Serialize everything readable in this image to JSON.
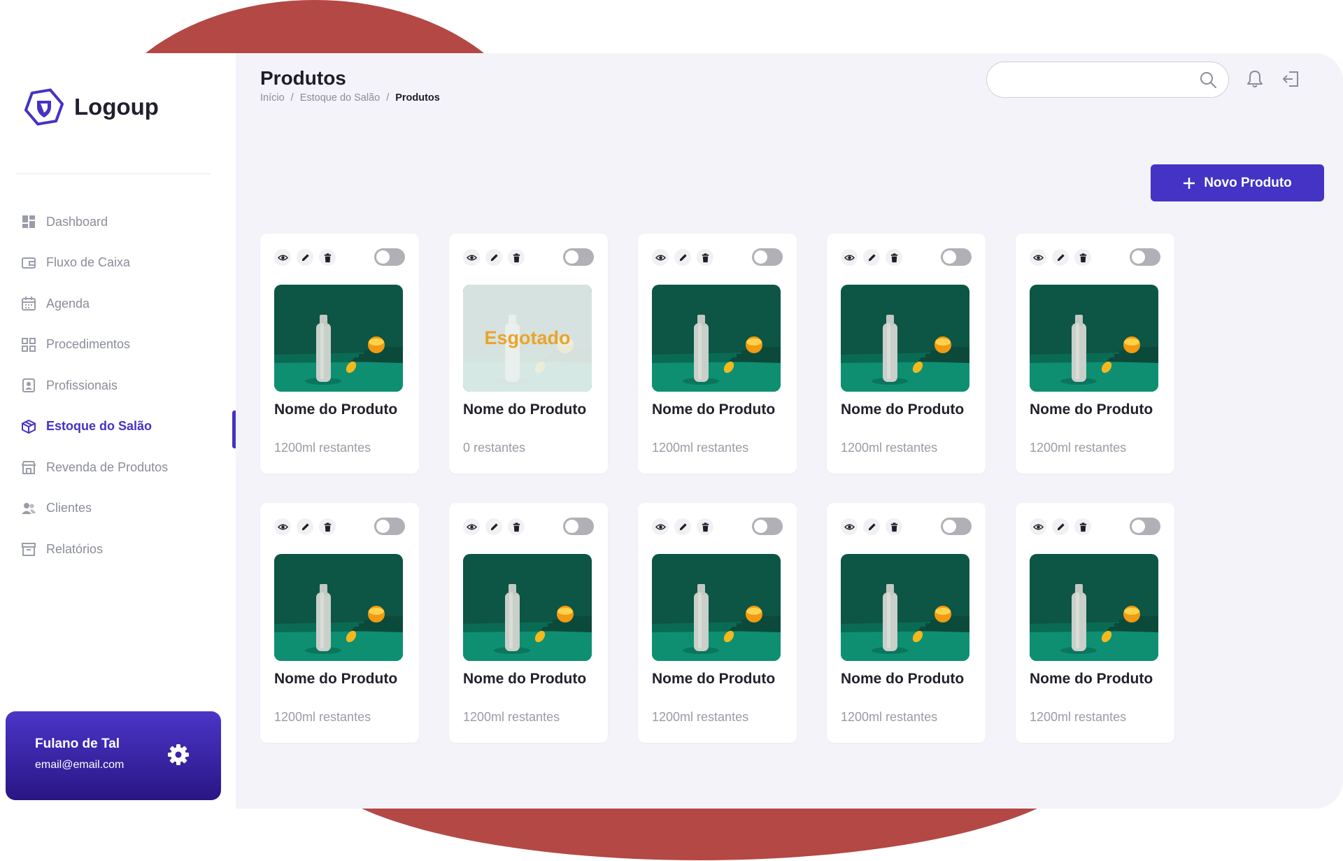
{
  "brand": {
    "name": "Logoup"
  },
  "nav": {
    "items": [
      {
        "label": "Dashboard",
        "icon": "dashboard-icon",
        "active": false
      },
      {
        "label": "Fluxo de Caixa",
        "icon": "wallet-icon",
        "active": false
      },
      {
        "label": "Agenda",
        "icon": "calendar-icon",
        "active": false
      },
      {
        "label": "Procedimentos",
        "icon": "grid-icon",
        "active": false
      },
      {
        "label": "Profissionais",
        "icon": "id-badge-icon",
        "active": false
      },
      {
        "label": "Estoque do Salão",
        "icon": "box-icon",
        "active": true
      },
      {
        "label": "Revenda de Produtos",
        "icon": "store-icon",
        "active": false
      },
      {
        "label": "Clientes",
        "icon": "users-icon",
        "active": false
      },
      {
        "label": "Relatórios",
        "icon": "archive-icon",
        "active": false
      }
    ]
  },
  "user": {
    "name": "Fulano de Tal",
    "email": "email@email.com"
  },
  "header": {
    "title": "Produtos",
    "breadcrumb": [
      "Início",
      "Estoque do Salão",
      "Produtos"
    ],
    "search_placeholder": "",
    "new_button_label": "Novo Produto"
  },
  "colors": {
    "accent": "#4433c4",
    "background": "#f3f3f9",
    "blob": "#b34845",
    "soldout": "#e8a52a"
  },
  "products": [
    {
      "name": "Nome do Produto",
      "stock": "1200ml restantes",
      "soldout": false,
      "badge": ""
    },
    {
      "name": "Nome do Produto",
      "stock": "0 restantes",
      "soldout": true,
      "badge": "Esgotado"
    },
    {
      "name": "Nome do Produto",
      "stock": "1200ml restantes",
      "soldout": false,
      "badge": ""
    },
    {
      "name": "Nome do Produto",
      "stock": "1200ml restantes",
      "soldout": false,
      "badge": ""
    },
    {
      "name": "Nome do Produto",
      "stock": "1200ml restantes",
      "soldout": false,
      "badge": ""
    },
    {
      "name": "Nome do Produto",
      "stock": "1200ml restantes",
      "soldout": false,
      "badge": ""
    },
    {
      "name": "Nome do Produto",
      "stock": "1200ml restantes",
      "soldout": false,
      "badge": ""
    },
    {
      "name": "Nome do Produto",
      "stock": "1200ml restantes",
      "soldout": false,
      "badge": ""
    },
    {
      "name": "Nome do Produto",
      "stock": "1200ml restantes",
      "soldout": false,
      "badge": ""
    },
    {
      "name": "Nome do Produto",
      "stock": "1200ml restantes",
      "soldout": false,
      "badge": ""
    }
  ]
}
